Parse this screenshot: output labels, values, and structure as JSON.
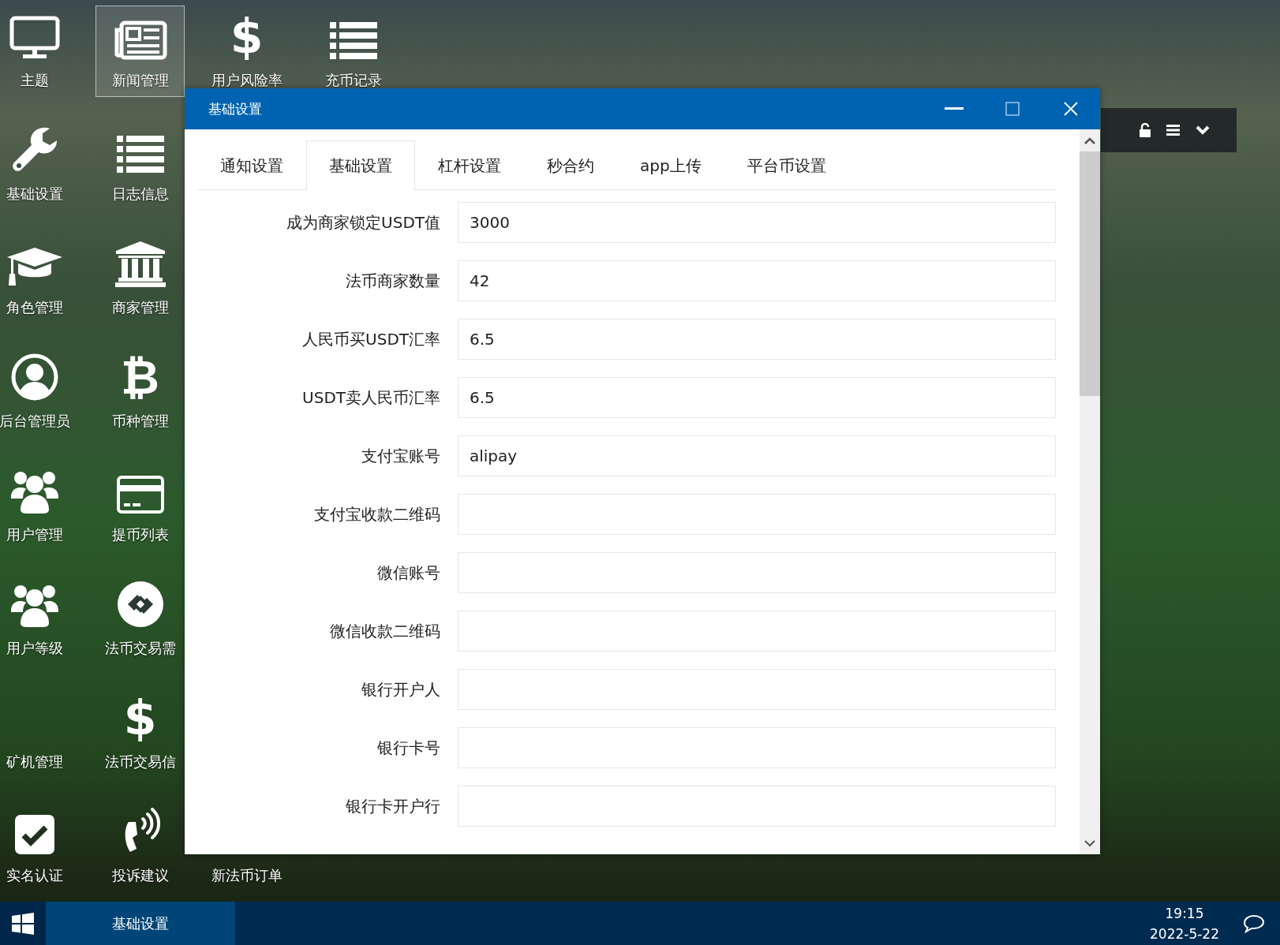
{
  "desktop": {
    "icons": [
      {
        "label": "主题",
        "kind": "monitor",
        "selected": false
      },
      {
        "label": "基础设置",
        "kind": "wrench",
        "selected": false
      },
      {
        "label": "角色管理",
        "kind": "cap",
        "selected": false
      },
      {
        "label": "后台管理员",
        "kind": "user",
        "selected": false
      },
      {
        "label": "用户管理",
        "kind": "users",
        "selected": false
      },
      {
        "label": "用户等级",
        "kind": "users",
        "selected": false
      },
      {
        "label": "矿机管理",
        "kind": "covered",
        "selected": false
      },
      {
        "label": "实名认证",
        "kind": "check",
        "selected": false
      },
      {
        "label": "新闻管理",
        "kind": "newspaper",
        "selected": true
      },
      {
        "label": "日志信息",
        "kind": "list",
        "selected": false
      },
      {
        "label": "商家管理",
        "kind": "bank",
        "selected": false
      },
      {
        "label": "币种管理",
        "kind": "glyph",
        "glyph": "₿",
        "selected": false
      },
      {
        "label": "提币列表",
        "kind": "card",
        "selected": false
      },
      {
        "label": "法币交易需",
        "kind": "exchange",
        "selected": false
      },
      {
        "label": "法币交易信",
        "kind": "glyph",
        "glyph": "$",
        "selected": false
      },
      {
        "label": "投诉建议",
        "kind": "phone",
        "selected": false
      },
      {
        "label": "用户风险率",
        "kind": "glyph",
        "glyph": "$",
        "selected": false
      },
      {
        "label": "新法币订单",
        "kind": "covered",
        "selected": false
      },
      {
        "label": "充币记录",
        "kind": "list",
        "selected": false
      }
    ]
  },
  "window": {
    "title": "基础设置",
    "tabs": [
      {
        "label": "通知设置",
        "selected": false
      },
      {
        "label": "基础设置",
        "selected": true
      },
      {
        "label": "杠杆设置",
        "selected": false
      },
      {
        "label": "秒合约",
        "selected": false
      },
      {
        "label": "app上传",
        "selected": false
      },
      {
        "label": "平台币设置",
        "selected": false
      }
    ],
    "fields": [
      {
        "label": "成为商家锁定USDT值",
        "value": "3000"
      },
      {
        "label": "法币商家数量",
        "value": "42"
      },
      {
        "label": "人民币买USDT汇率",
        "value": "6.5"
      },
      {
        "label": "USDT卖人民币汇率",
        "value": "6.5"
      },
      {
        "label": "支付宝账号",
        "value": "alipay"
      },
      {
        "label": "支付宝收款二维码"
      },
      {
        "label": "微信账号"
      },
      {
        "label": "微信收款二维码"
      },
      {
        "label": "银行开户人"
      },
      {
        "label": "银行卡号"
      },
      {
        "label": "银行卡开户行"
      }
    ]
  },
  "taskbar": {
    "tasks": [
      {
        "label": "基础设置",
        "selected": true
      }
    ],
    "time": "19:15",
    "date": "2022-5-22"
  }
}
